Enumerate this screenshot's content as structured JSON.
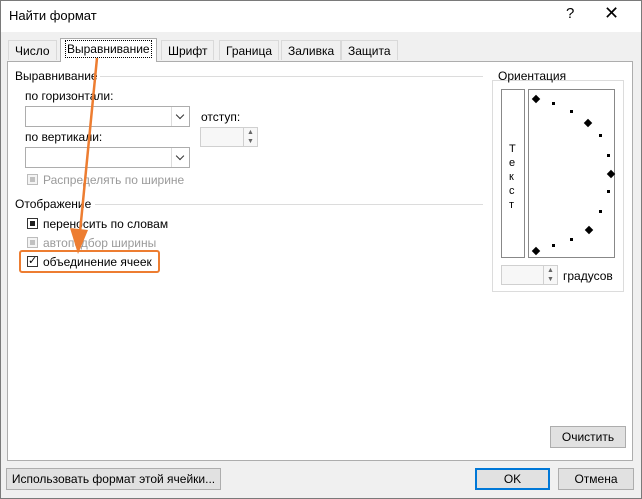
{
  "window": {
    "title": "Найти формат",
    "help": "?",
    "close": "✕"
  },
  "tabs": [
    "Число",
    "Выравнивание",
    "Шрифт",
    "Граница",
    "Заливка",
    "Защита"
  ],
  "active_tab": "Выравнивание",
  "alignment": {
    "group_label": "Выравнивание",
    "horizontal_label": "по горизонтали:",
    "horizontal_value": "",
    "indent_label": "отступ:",
    "indent_value": "",
    "vertical_label": "по вертикали:",
    "vertical_value": "",
    "distribute_label": "Распределять по ширине"
  },
  "display": {
    "group_label": "Отображение",
    "wrap_label": "переносить по словам",
    "shrink_label": "автоподбор ширины",
    "merge_label": "объединение ячеек"
  },
  "orientation": {
    "group_label": "Ориентация",
    "vertical_text": [
      "Т",
      "е",
      "к",
      "с",
      "т"
    ],
    "degrees_label": "градусов",
    "degrees_value": ""
  },
  "buttons": {
    "clear": "Очистить",
    "use_cell_format": "Использовать формат этой ячейки...",
    "ok": "OK",
    "cancel": "Отмена"
  },
  "colors": {
    "annotation": "#ed7d31",
    "default_button_border": "#0078d7"
  }
}
